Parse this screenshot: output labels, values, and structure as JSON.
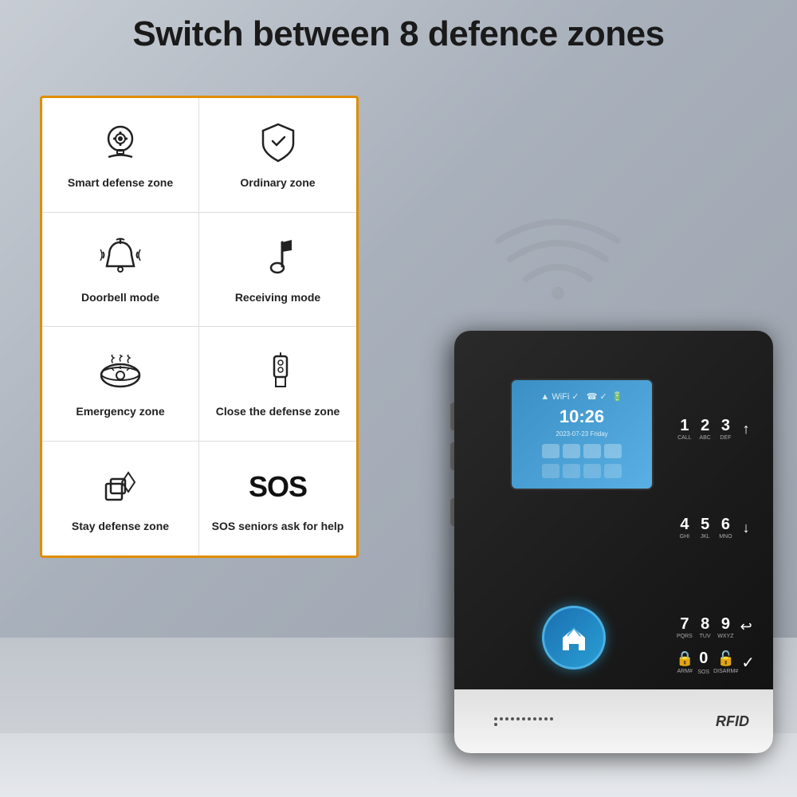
{
  "title": "Switch between 8 defence zones",
  "zones": [
    {
      "id": "smart-defense",
      "label": "Smart defense zone",
      "icon": "brain-gear"
    },
    {
      "id": "ordinary",
      "label": "Ordinary zone",
      "icon": "shield"
    },
    {
      "id": "doorbell",
      "label": "Doorbell mode",
      "icon": "bell"
    },
    {
      "id": "receiving",
      "label": "Receiving mode",
      "icon": "music-note"
    },
    {
      "id": "emergency",
      "label": "Emergency zone",
      "icon": "smoke-detector"
    },
    {
      "id": "close-defense",
      "label": "Close the defense zone",
      "icon": "key"
    },
    {
      "id": "stay-defense",
      "label": "Stay defense zone",
      "icon": "shapes"
    },
    {
      "id": "sos",
      "label": "SOS seniors ask for help",
      "icon": "sos"
    }
  ],
  "device": {
    "rfid_label": "RFID",
    "screen": {
      "time": "10:26",
      "date": "2023-07-23  Friday"
    },
    "keypad": [
      {
        "num": "1",
        "sub": "CALL",
        "row": 1,
        "col": 1
      },
      {
        "num": "2",
        "sub": "ABC",
        "row": 1,
        "col": 2
      },
      {
        "num": "3",
        "sub": "DEF",
        "row": 1,
        "col": 3
      },
      {
        "num": "↑",
        "sub": "",
        "row": 1,
        "col": 4
      },
      {
        "num": "4",
        "sub": "GHI",
        "row": 2,
        "col": 1
      },
      {
        "num": "5",
        "sub": "JKL",
        "row": 2,
        "col": 2
      },
      {
        "num": "6",
        "sub": "MNO",
        "row": 2,
        "col": 3
      },
      {
        "num": "↓",
        "sub": "",
        "row": 2,
        "col": 4
      },
      {
        "num": "7",
        "sub": "PQRS",
        "row": 3,
        "col": 1
      },
      {
        "num": "8",
        "sub": "TUV",
        "row": 3,
        "col": 2
      },
      {
        "num": "9",
        "sub": "WXYZ",
        "row": 3,
        "col": 3
      },
      {
        "num": "↩",
        "sub": "",
        "row": 3,
        "col": 4
      }
    ],
    "bottom_keys": [
      {
        "symbol": "🔒",
        "label": "ARM#"
      },
      {
        "symbol": "0",
        "label": "SOS"
      },
      {
        "symbol": "🔓",
        "label": "DISARM#"
      },
      {
        "symbol": "✓",
        "label": ""
      }
    ]
  },
  "wifi_icon": "wifi",
  "accent_color": "#e08c00",
  "device_color": "#1a1a1a"
}
